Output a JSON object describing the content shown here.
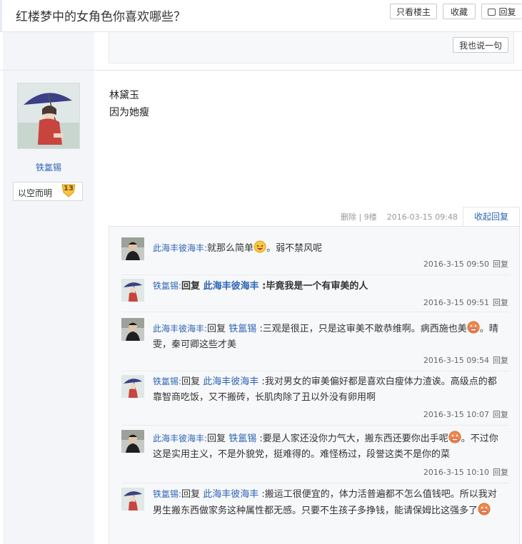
{
  "header": {
    "title": "红楼梦中的女角色你喜欢哪些？",
    "only_op_label": "只看楼主",
    "favorite_label": "收藏",
    "reply_label": "回复"
  },
  "prev_floor": {
    "say_label": "我也说一句"
  },
  "post": {
    "author": "铁氲锡",
    "badge_label": "以空而明",
    "badge_level": "13",
    "content_lines": [
      "林黛玉",
      "因为她瘦"
    ],
    "delete_label": "删除",
    "floor": "9楼",
    "time": "2016-03-15 09:48",
    "collapse_label": "收起回复"
  },
  "comments": [
    {
      "user": "此海丰彼海丰:",
      "parts": [
        {
          "text": "就那么简单"
        },
        {
          "emoji": "laughing-face-emoji"
        },
        {
          "text": "。弱不禁风呢"
        }
      ],
      "time": "2016-3-15 09:50",
      "reply_label": "回复"
    },
    {
      "user": "铁氲锡:",
      "parts": [
        {
          "text": "回复 ",
          "strong": true
        },
        {
          "text": "此海丰彼海丰",
          "target": true,
          "strong": true
        },
        {
          "text": " :毕竟我是一个有审美的人",
          "strong": true
        }
      ],
      "time": "2016-3-15 09:51",
      "reply_label": "回复"
    },
    {
      "user": "此海丰彼海丰:",
      "parts": [
        {
          "text": "回复 "
        },
        {
          "text": "铁氲锡",
          "target": true
        },
        {
          "text": " :三观是很正，只是这审美不敢恭维啊。病西施也美"
        },
        {
          "emoji": "grimace-face-emoji"
        },
        {
          "text": "。晴雯，秦可卿这些才美"
        }
      ],
      "time": "2016-3-15 09:54",
      "reply_label": "回复"
    },
    {
      "user": "铁氲锡:",
      "parts": [
        {
          "text": "回复 "
        },
        {
          "text": "此海丰彼海丰",
          "target": true
        },
        {
          "text": " :我对男女的审美偏好都是喜欢白瘦体力渣诶。高级点的都靠智商吃饭，又不搬砖，长肌肉除了丑以外没有卵用啊"
        }
      ],
      "time": "2016-3-15 10:07",
      "reply_label": "回复"
    },
    {
      "user": "此海丰彼海丰:",
      "parts": [
        {
          "text": "回复 "
        },
        {
          "text": "铁氲锡",
          "target": true
        },
        {
          "text": " :要是人家还没你力气大，搬东西还要你出手呢"
        },
        {
          "emoji": "grimace-face-emoji"
        },
        {
          "text": "。不过你这是实用主义，不是外貌党，挺难得的。难怪杨过，段誉这类不是你的菜"
        }
      ],
      "time": "2016-3-15 10:10",
      "reply_label": "回复"
    },
    {
      "user": "铁氲锡:",
      "parts": [
        {
          "text": "回复 "
        },
        {
          "text": "此海丰彼海丰",
          "target": true
        },
        {
          "text": " :搬运工很便宜的，体力活普遍都不怎么值钱吧。所以我对男生搬东西做家务这种属性都无感。只要不生孩子多挣钱，能请保姆比这强多了"
        },
        {
          "emoji": "grimace-face-emoji"
        }
      ],
      "time": "",
      "reply_label": ""
    }
  ],
  "colors": {
    "link_blue": "#2d64b3",
    "sidebar_bg": "#f3f5f9",
    "comment_bg": "#f7f8fa"
  }
}
